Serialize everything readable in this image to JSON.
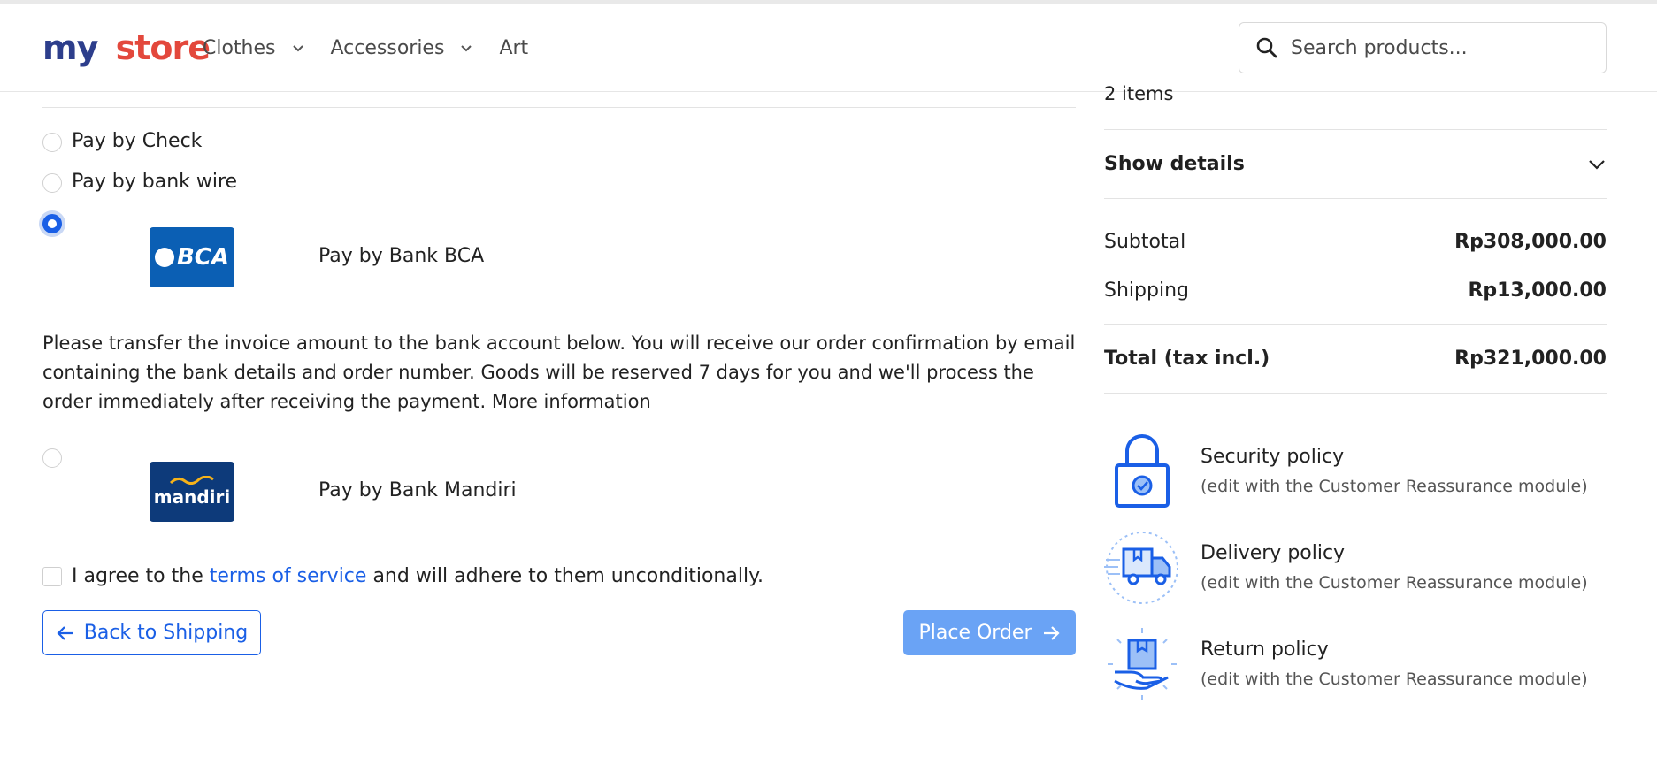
{
  "header": {
    "logo_parts": [
      "my",
      "store"
    ],
    "nav": [
      {
        "label": "Clothes",
        "has_dropdown": true
      },
      {
        "label": "Accessories",
        "has_dropdown": true
      },
      {
        "label": "Art",
        "has_dropdown": false
      }
    ],
    "search": {
      "placeholder": "Search products...",
      "value": ""
    }
  },
  "payment": {
    "options": [
      {
        "label": "Pay by Check",
        "selected": false
      },
      {
        "label": "Pay by bank wire",
        "selected": false
      },
      {
        "label": "Pay by Bank BCA",
        "selected": true,
        "logo_text": "BCA"
      },
      {
        "label": "Pay by Bank Mandiri",
        "selected": false,
        "logo_text": "mandiri"
      }
    ],
    "bca_description": "Please transfer the invoice amount to the bank account below. You will receive our order confirmation by email containing the bank details and order number. Goods will be reserved 7 days for you and we'll process the order immediately after receiving the payment. More information",
    "terms": {
      "prefix": "I agree to the ",
      "link": "terms of service",
      "suffix": " and will adhere to them unconditionally.",
      "checked": false
    },
    "back_label": "Back to Shipping",
    "place_order_label": "Place Order"
  },
  "summary": {
    "items_count": "2 items",
    "show_details": "Show details",
    "subtotal_label": "Subtotal",
    "subtotal_value": "Rp308,000.00",
    "shipping_label": "Shipping",
    "shipping_value": "Rp13,000.00",
    "total_label": "Total (tax incl.)",
    "total_value": "Rp321,000.00"
  },
  "reassurance": [
    {
      "title": "Security policy",
      "subtitle": "(edit with the Customer Reassurance module)",
      "icon": "lock-icon"
    },
    {
      "title": "Delivery policy",
      "subtitle": "(edit with the Customer Reassurance module)",
      "icon": "truck-icon"
    },
    {
      "title": "Return policy",
      "subtitle": "(edit with the Customer Reassurance module)",
      "icon": "return-box-icon"
    }
  ],
  "colors": {
    "primary": "#1a5fe6",
    "place_order_bg": "#6aa3f5",
    "bca_blue": "#0b5fb4",
    "mandiri_blue": "#0d3a7a"
  }
}
